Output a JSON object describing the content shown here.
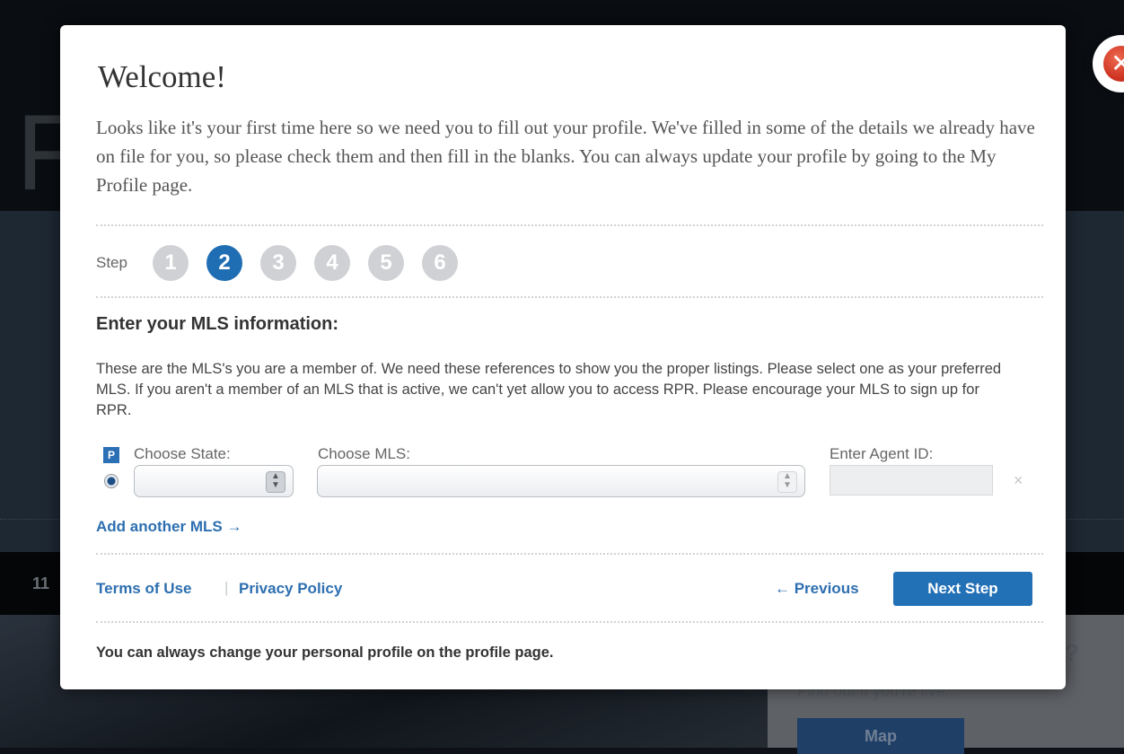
{
  "background": {
    "logo_letter": "F",
    "bar_number": "11",
    "side_question": "?",
    "side_text": "Find out if you're live...",
    "map_button": "Map"
  },
  "modal": {
    "title": "Welcome!",
    "intro": "Looks like it's your first time here so we need you to fill out your profile. We've filled in some of the details we already have on file for you, so please check them and then fill in the blanks. You can always update your profile by going to the My Profile page.",
    "close_icon": "close-icon",
    "step_label": "Step",
    "steps": [
      "1",
      "2",
      "3",
      "4",
      "5",
      "6"
    ],
    "active_step": 2,
    "section_title": "Enter your MLS information:",
    "description": "These are the MLS's you are a member of. We need these references to show you the proper listings. Please select one as your preferred MLS. If you aren't a member of an MLS that is active, we can't yet allow you to access RPR. Please encourage your MLS to sign up for RPR.",
    "preferred_badge": "P",
    "state_label": "Choose State:",
    "mls_label": "Choose MLS:",
    "agent_label": "Enter Agent ID:",
    "state_value": "",
    "mls_value": "",
    "agent_id_value": "",
    "remove_symbol": "×",
    "add_mls": "Add another MLS →",
    "terms": "Terms of Use",
    "separator": "|",
    "privacy": "Privacy Policy",
    "previous": "← Previous",
    "next": "Next Step",
    "footnote": "You can always change your personal profile on the profile page."
  },
  "colors": {
    "accent": "#2270b6",
    "link": "#2d6fb0",
    "step_inactive": "#cfd1d4",
    "close": "#cf3522"
  }
}
